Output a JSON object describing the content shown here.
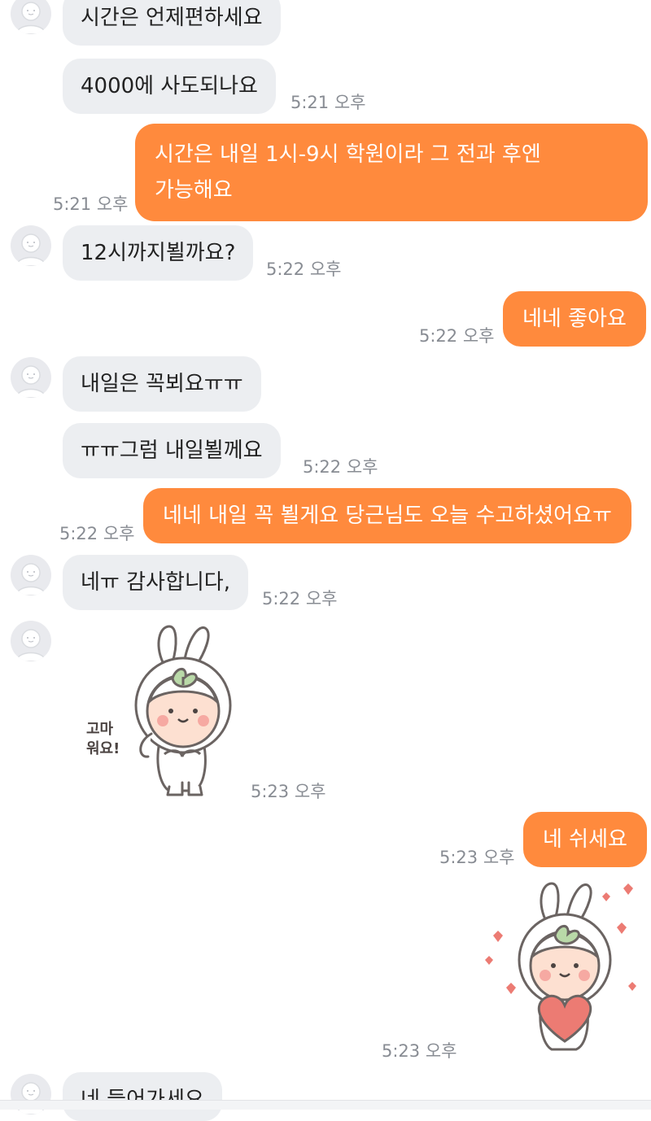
{
  "messages": [
    {
      "text": "시간은 언제편하세요"
    },
    {
      "text": "4000에  사도되나요",
      "time": "5:21 오후"
    },
    {
      "line1": "시간은 내일 1시-9시 학원이라 그 전과 후엔",
      "line2": "가능해요",
      "time": "5:21 오후"
    },
    {
      "text": "12시까지뵐까요?",
      "time": "5:22 오후"
    },
    {
      "text": "네네 좋아요",
      "time": "5:22 오후"
    },
    {
      "text": "내일은  꼭뵈요ㅠㅠ"
    },
    {
      "text": "ㅠㅠ그럼  내일뵐께요",
      "time": "5:22 오후"
    },
    {
      "text": "네네 내일 꼭 뵐게요 당근님도 오늘 수고하셨어요ㅠ",
      "time": "5:22 오후"
    },
    {
      "text": "네ㅠ 감사합니다,",
      "time": "5:22 오후"
    },
    {
      "sticker_caption_1": "고마",
      "sticker_caption_2": "워요!",
      "time": "5:23 오후"
    },
    {
      "text": "네 쉬세요",
      "time": "5:23 오후"
    },
    {
      "time": "5:23 오후"
    },
    {
      "text": "네    들어가세요"
    }
  ],
  "colors": {
    "outgoing": "#ff8a3d",
    "incoming": "#eceef1",
    "timestamp": "#888c93"
  }
}
